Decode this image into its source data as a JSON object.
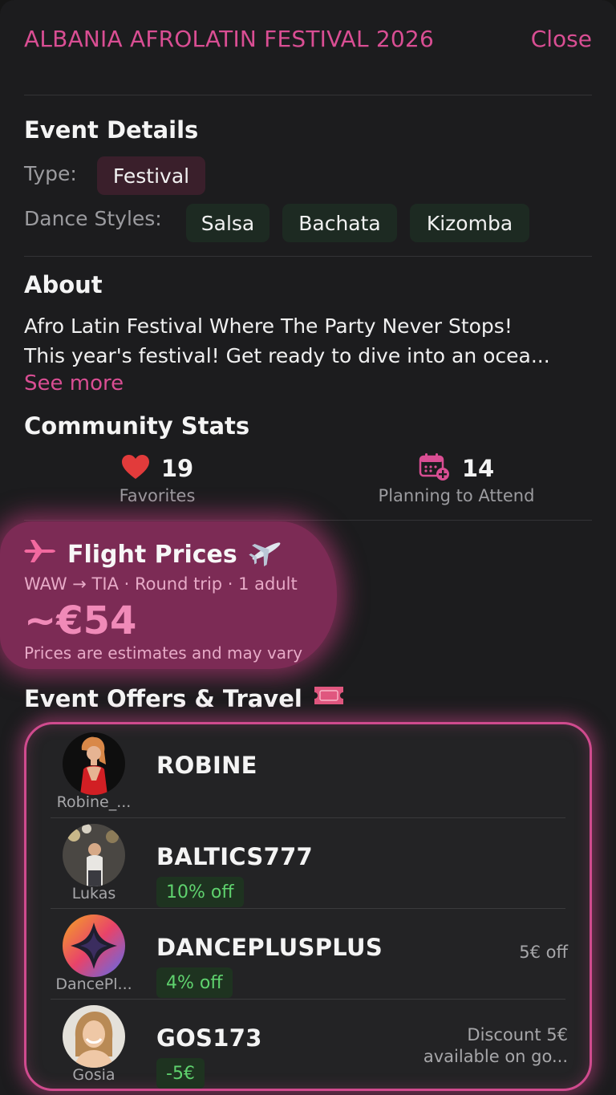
{
  "header": {
    "title": "ALBANIA AFROLATIN FESTIVAL 2026",
    "close_label": "Close"
  },
  "event_details": {
    "heading": "Event Details",
    "type_label": "Type:",
    "type_value": "Festival",
    "styles_label": "Dance Styles:",
    "styles": [
      "Salsa",
      "Bachata",
      "Kizomba"
    ]
  },
  "about": {
    "heading": "About",
    "line1": "Afro Latin Festival Where The Party Never Stops!",
    "line2": "This year's festival! Get ready to dive into an ocea...",
    "see_more": "See more"
  },
  "community_stats": {
    "heading": "Community Stats",
    "favorites_count": "19",
    "favorites_label": "Favorites",
    "attending_count": "14",
    "attending_label": "Planning to Attend"
  },
  "flight": {
    "title": "Flight Prices",
    "route": "WAW → TIA · Round trip · 1 adult",
    "price": "~€54",
    "note": "Prices are estimates and may vary"
  },
  "offers": {
    "heading": "Event Offers & Travel",
    "items": [
      {
        "avatar_name": "Robine_...",
        "code": "ROBINE",
        "discount": "",
        "extra_line1": "",
        "extra_line2": ""
      },
      {
        "avatar_name": "Lukas",
        "code": "BALTICS777",
        "discount": "10% off",
        "extra_line1": "",
        "extra_line2": ""
      },
      {
        "avatar_name": "DancePl...",
        "code": "DANCEPLUSPLUS",
        "discount": "4% off",
        "extra_line1": "5€ off",
        "extra_line2": ""
      },
      {
        "avatar_name": "Gosia",
        "code": "GOS173",
        "discount": "-5€",
        "extra_line1": "Discount 5€",
        "extra_line2": "available on go..."
      }
    ]
  },
  "colors": {
    "accent": "#d94e93",
    "background": "#1c1c1e",
    "discount_green": "#5fd26e",
    "flight_card": "#7c2b55"
  }
}
